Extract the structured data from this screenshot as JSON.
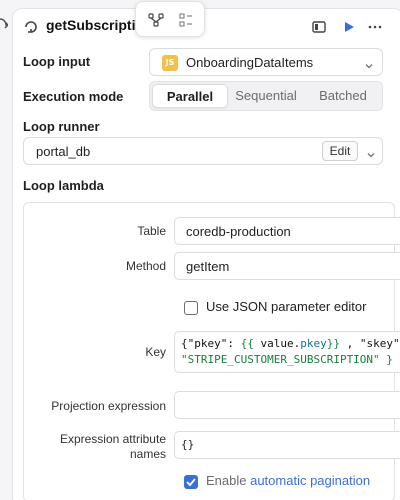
{
  "header": {
    "title": "getSubscription",
    "icons": [
      "loop-icon",
      "branch-icon",
      "list-icon",
      "panel-icon",
      "play-icon",
      "more-icon"
    ]
  },
  "loop_input": {
    "label": "Loop input",
    "badge": "JS",
    "value": "OnboardingDataItems"
  },
  "execution_mode": {
    "label": "Execution mode",
    "options": [
      "Parallel",
      "Sequential",
      "Batched"
    ],
    "selected": "Parallel"
  },
  "loop_runner": {
    "label": "Loop runner",
    "value": "portal_db",
    "edit_label": "Edit"
  },
  "loop_lambda": {
    "label": "Loop lambda",
    "table": {
      "label": "Table",
      "value": "coredb-production"
    },
    "method": {
      "label": "Method",
      "value": "getItem"
    },
    "json_editor": {
      "label": "Use JSON parameter editor",
      "checked": false
    },
    "key": {
      "label": "Key",
      "line1_parts": [
        "{\"pkey\": ",
        "{{ ",
        "value",
        ".",
        "pkey",
        "}}",
        " , \"skey\""
      ],
      "line2": "\"STRIPE_CUSTOMER_SUBSCRIPTION\" }"
    },
    "projection": {
      "label": "Projection expression",
      "value": ""
    },
    "expr_attr_names": {
      "label_line1": "Expression attribute",
      "label_line2": "names",
      "value": "{}"
    },
    "pagination": {
      "prefix": "Enable ",
      "link": "automatic pagination",
      "checked": true
    }
  },
  "colors": {
    "accent": "#3b6fd8",
    "js_badge": "#f2c14a",
    "code_green": "#15803d"
  }
}
